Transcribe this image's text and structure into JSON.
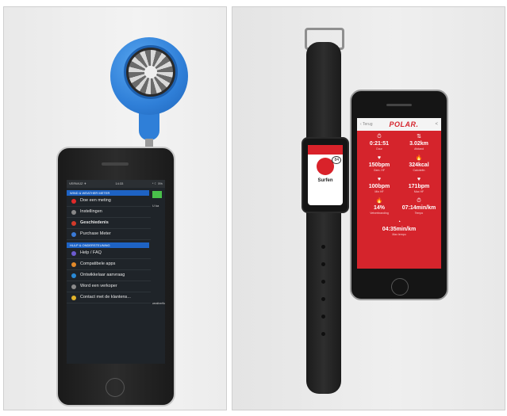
{
  "left_phone": {
    "status": {
      "left": "VERWIJZ ✈",
      "center": "14:33",
      "right": "* ☾ 5%"
    },
    "section_weather": "WIND & WEATHER METER",
    "menu_weather": [
      {
        "label": "Doe een meting",
        "dot": "#e02a2a"
      },
      {
        "label": "Instellingen",
        "dot": "#888888"
      },
      {
        "label": "Geschiedenis",
        "dot": "#d23a2a"
      },
      {
        "label": "Purchase Meter",
        "dot": "#3a7ad6"
      }
    ],
    "section_help": "HULP & ONDERSTEUNING",
    "menu_help": [
      {
        "label": "Help / FAQ",
        "dot": "#6d5bd0"
      },
      {
        "label": "Compatibele apps",
        "dot": "#e28a2a"
      },
      {
        "label": "Ontwikkelaar aanvraag",
        "dot": "#2a8ad6"
      },
      {
        "label": "Word een verkoper",
        "dot": "#8a8a8a"
      },
      {
        "label": "Contact met de klantens...",
        "dot": "#e2b32a"
      }
    ],
    "side_text": "U ka",
    "footer_logo": "weatherflow"
  },
  "watch": {
    "badge": "84",
    "activity": "Surfen"
  },
  "right_phone": {
    "back": "‹ Terug",
    "logo": "POLAR.",
    "share": "<",
    "stats": [
      {
        "icon": "⏱",
        "value": "0:21:51",
        "sub": "Duur"
      },
      {
        "icon": "⇅",
        "value": "3.02km",
        "sub": "Afstand"
      },
      {
        "icon": "♥",
        "value": "150bpm",
        "sub": "Gem. HF"
      },
      {
        "icon": "🔥",
        "value": "324kcal",
        "sub": "Calorieën"
      },
      {
        "icon": "♥",
        "value": "100bpm",
        "sub": "Min HF"
      },
      {
        "icon": "♥",
        "value": "171bpm",
        "sub": "Max HF"
      },
      {
        "icon": "🔥",
        "value": "14%",
        "sub": "Vetverbranding"
      },
      {
        "icon": "⏱",
        "value": "07:14min/km",
        "sub": "Tempo"
      }
    ],
    "last_stat": {
      "icon": "◔",
      "value": "04:35min/km",
      "sub": "Max tempo"
    }
  }
}
